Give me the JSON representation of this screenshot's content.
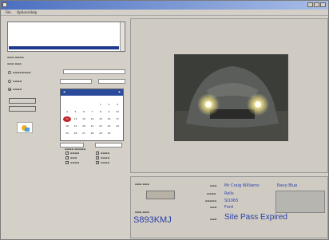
{
  "window": {
    "title": ""
  },
  "menu": [
    "File",
    "Options",
    "Help"
  ],
  "list_rows": [
    {
      "c1": "",
      "c2": "",
      "c3": "",
      "c4": "",
      "c5": "",
      "sel": false
    },
    {
      "c1": "",
      "c2": "",
      "c3": "",
      "c4": "",
      "c5": "",
      "sel": false
    },
    {
      "c1": "",
      "c2": "",
      "c3": "",
      "c4": "",
      "c5": "",
      "sel": false
    },
    {
      "c1": "",
      "c2": "",
      "c3": "",
      "c4": "",
      "c5": "",
      "sel": false
    },
    {
      "c1": "",
      "c2": "",
      "c3": "",
      "c4": "",
      "c5": "",
      "sel": false
    },
    {
      "c1": "",
      "c2": "",
      "c3": "",
      "c4": "",
      "c5": "",
      "sel": true
    }
  ],
  "search": {
    "options": [
      "",
      "",
      ""
    ]
  },
  "calendar": {
    "header": "",
    "dow": [
      "",
      "",
      "",
      "",
      "",
      "",
      ""
    ],
    "days": [
      [
        "",
        "",
        "",
        "",
        "1",
        "2",
        "3"
      ],
      [
        "4",
        "5",
        "6",
        "7",
        "8",
        "9",
        "10"
      ],
      [
        "11",
        "12",
        "13",
        "14",
        "15",
        "16",
        "17"
      ],
      [
        "18",
        "19",
        "20",
        "21",
        "22",
        "23",
        "24"
      ],
      [
        "25",
        "26",
        "27",
        "28",
        "29",
        "30",
        ""
      ]
    ],
    "today": {
      "row": 2,
      "col": 0
    }
  },
  "categories": [
    "",
    "",
    "",
    "",
    "",
    ""
  ],
  "plate": {
    "value": "S893KMJ"
  },
  "details": {
    "name": "Mr Craig Williams",
    "name2": "Navy Blue",
    "colour": "Rolls",
    "make": "Ford",
    "model": "Ford",
    "status": "Site Pass Expired"
  }
}
